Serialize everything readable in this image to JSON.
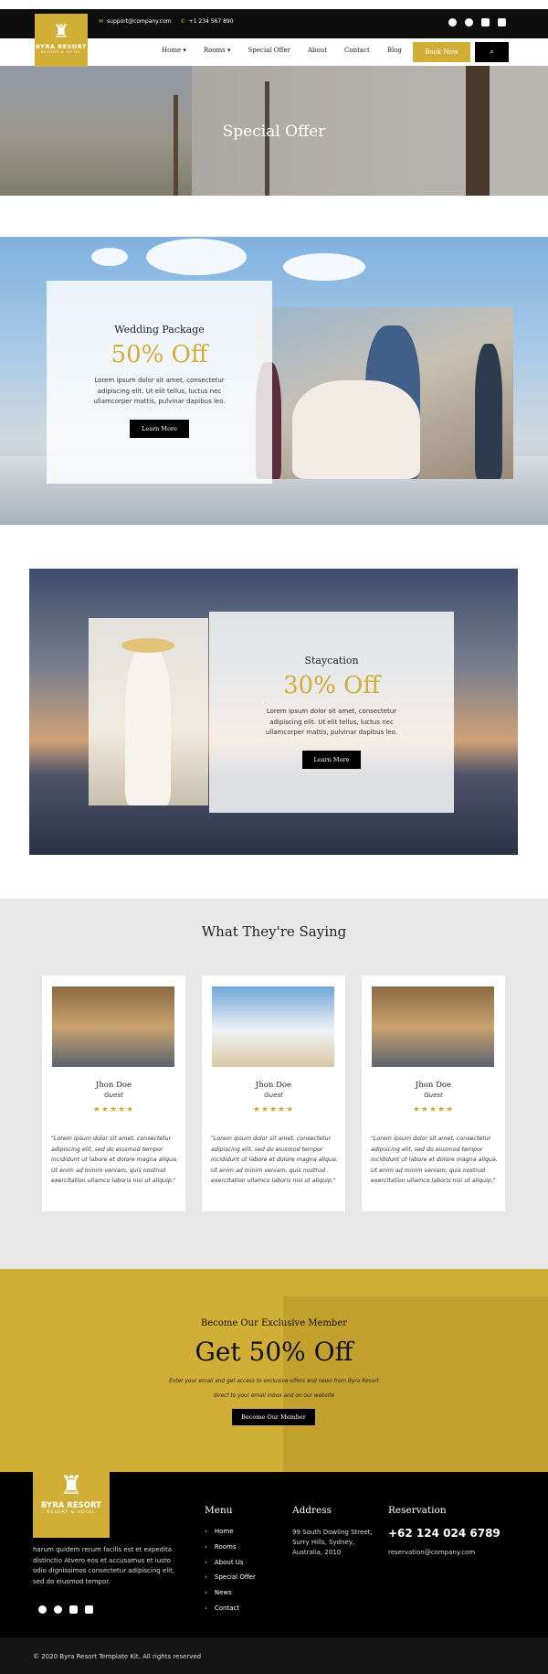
{
  "topbar": {
    "email": "support@company.com",
    "phone": "+1 234 567 890"
  },
  "logo": {
    "mark": "♜",
    "name": "BYRA RESORT",
    "sub": "RESORT & HOTEL"
  },
  "nav": {
    "items": [
      "Home ▾",
      "Rooms ▾",
      "Special Offer",
      "About",
      "Contact",
      "Blog"
    ],
    "book": "Book Now",
    "search_icon": "⌕"
  },
  "hero": {
    "title": "Special Offer"
  },
  "offers": [
    {
      "title": "Wedding Package",
      "discount": "50% Off",
      "text": "Lorem ipsum dolor sit amet, consectetur adipiscing elit. Ut elit tellus, luctus nec ullamcorper mattis, pulvinar dapibus leo.",
      "button": "Learn More"
    },
    {
      "title": "Staycation",
      "discount": "30% Off",
      "text": "Lorem ipsum dolor sit amet, consectetur adipiscing elit. Ut elit tellus, luctus nec ullamcorper mattis, pulvinar dapibus leo.",
      "button": "Learn More"
    }
  ],
  "testimonials": {
    "heading": "What They're Saying",
    "items": [
      {
        "name": "Jhon Doe",
        "role": "Guest",
        "stars": "★★★★★",
        "quote": "\"Lorem ipsum dolor sit amet, consectetur adipiscing elit, sed do eiusmod tempor incididunt ut labore et dolore magna aliqua. Ut enim ad minim veniam, quis nostrud exercitation ullamco laboris nisi ut aliquip.\""
      },
      {
        "name": "Jhon Doe",
        "role": "Guest",
        "stars": "★★★★★",
        "quote": "\"Lorem ipsum dolor sit amet, consectetur adipiscing elit, sed do eiusmod tempor incididunt ut labore et dolore magna aliqua. Ut enim ad minim veniam, quis nostrud exercitation ullamco laboris nisi ut aliquip.\""
      },
      {
        "name": "Jhon Doe",
        "role": "Guest",
        "stars": "★★★★★",
        "quote": "\"Lorem ipsum dolor sit amet, consectetur adipiscing elit, sed do eiusmod tempor incididunt ut labore et dolore magna aliqua. Ut enim ad minim veniam, quis nostrud exercitation ullamco laboris nisi ut aliquip.\""
      }
    ]
  },
  "member": {
    "kicker": "Become Our Exclusive Member",
    "headline": "Get 50% Off",
    "desc": "Enter your email and get access to exclusive offers and news from Byra Resort direct to your email inbox and on our website",
    "button": "Become Our Member"
  },
  "footer": {
    "about": "harum quidem rerum facilis est et expedita distinctio Atvero eos et accusamus et iusto odio dignissimos consectetur adipiscing elit, sed do eiusmod tempor.",
    "menu_heading": "Menu",
    "menu": [
      "Home",
      "Rooms",
      "About Us",
      "Special Offer",
      "News",
      "Contact"
    ],
    "address_heading": "Address",
    "address": "99 South Dowling Street, Surry Hills, Sydney, Australia, 2010",
    "reservation_heading": "Reservation",
    "phone": "+62 124 024 6789",
    "email": "reservation@company.com",
    "copyright": "© 2020 Byra Resort Template Kit. All rights reserved"
  },
  "colors": {
    "accent": "#d1ae36",
    "dark": "#000000",
    "light_bg": "#e8e8e8"
  }
}
